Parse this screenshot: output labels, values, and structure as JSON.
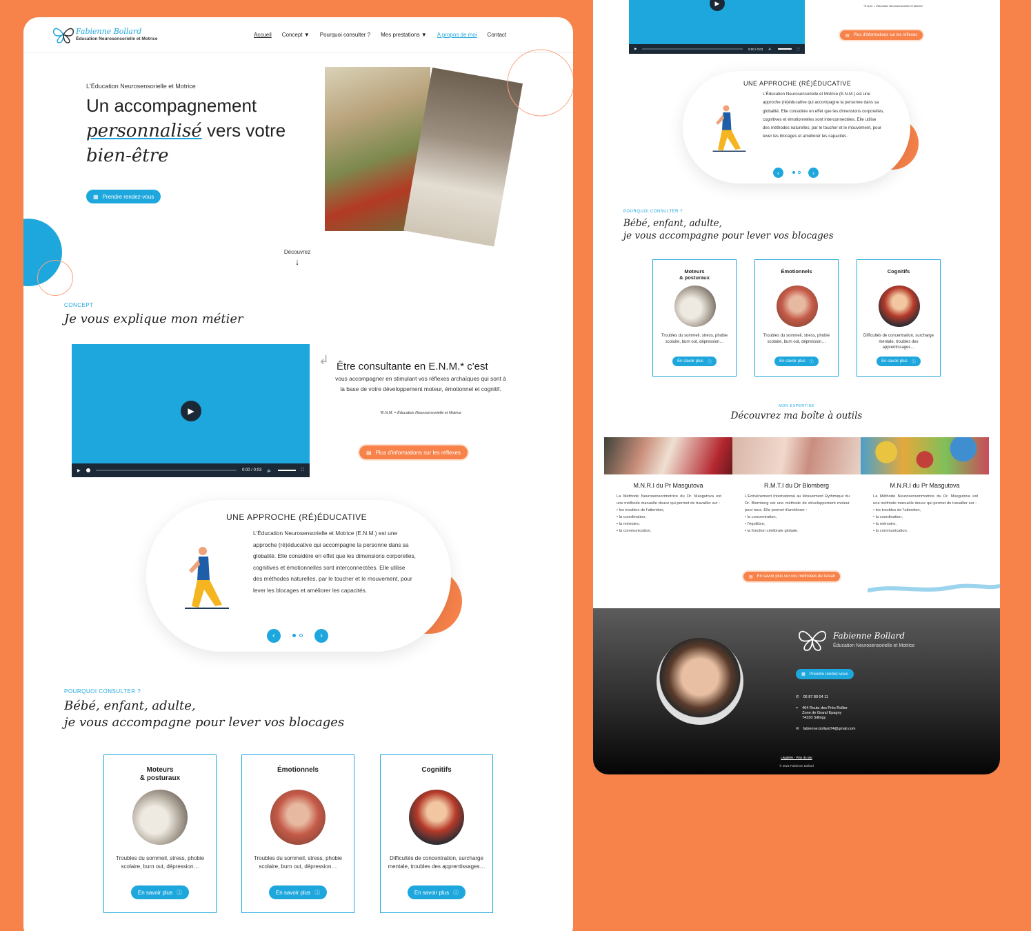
{
  "colors": {
    "background": "#f7824a",
    "accent_blue": "#1ea7dd",
    "accent_orange": "#f7824a",
    "dark": "#1b2937"
  },
  "brand": {
    "name": "Fabienne Bollard",
    "subtitle": "Éducation Neurosensorielle et Motrice"
  },
  "nav": {
    "items": [
      "Accueil",
      "Concept ▼",
      "Pourquoi consulter ?",
      "Mes prestations ▼",
      "A propos de moi",
      "Contact"
    ]
  },
  "hero": {
    "kicker": "L'Éducation Neurosensorielle et Motrice",
    "line1": "Un accompagnement",
    "line2_highlight": "personnalisé",
    "line2_rest": "vers votre",
    "line3": "bien-être",
    "cta": "Prendre rendez-vous",
    "discover": "Découvrez"
  },
  "concept": {
    "tag": "CONCEPT",
    "title": "Je vous explique mon métier",
    "heading": "Être consultante en E.N.M.* c'est",
    "text": "vous accompagner en stimulant vos réflexes archaïques qui sont à la base de votre développement moteur, émotionnel et cognitif.",
    "footnote": "*E.N.M. = Éducation Neurosensorielle et Motrice",
    "cta": "Plus d'informations sur les réflexes",
    "video_time": "0:00 / 0:03",
    "video_time_small": "0:00 / 0:03"
  },
  "approach": {
    "title": "UNE APPROCHE (RÉ)ÉDUCATIVE",
    "text": "L'Éducation Neurosensorielle et Motrice (E.N.M.) est une approche (ré)éducative qui accompagne la personne dans sa globalité. Elle considère en effet que les dimensions corporelles, cognitives et émotionnelles sont interconnectées. Elle utilise des méthodes naturelles, par le toucher et le mouvement, pour lever les blocages et améliorer les capacités.",
    "prev": "‹",
    "next": "›"
  },
  "why": {
    "tag": "POURQUOI CONSULTER ?",
    "title1": "Bébé, enfant, adulte,",
    "title2": "je vous accompagne pour lever vos blocages",
    "cards": [
      {
        "title": "Moteurs\n& posturaux",
        "desc": "Troubles du sommeil, stress, phobie scolaire, burn out, dépression…",
        "button": "En savoir plus"
      },
      {
        "title": "Émotionnels",
        "desc": "Troubles du sommeil, stress, phobie scolaire, burn out, dépression…",
        "button": "En savoir plus"
      },
      {
        "title": "Cognitifs",
        "desc": "Difficultés de concentration, surcharge mentale, troubles des apprentissages…",
        "button": "En savoir plus"
      }
    ]
  },
  "expertise": {
    "tag": "MON EXPERTISE",
    "title": "Découvrez ma boîte à outils",
    "tools": [
      {
        "title": "M.N.R.I du Pr Masgutova",
        "intro": "La Méthode Neurosensorimotrice du Dr. Masgutova est une méthode manuelle douce qui permet de travailler sur :",
        "points": [
          "les troubles de l'attention,",
          "la coordination,",
          "la mémoire,",
          "la communication."
        ]
      },
      {
        "title": "R.M.T.I du Dr Blomberg",
        "intro": "L'Entraînement International au Mouvement Rythmique du Dr. Blomberg est une méthode de développement moteur pour tous. Elle permet d'améliorer :",
        "points": [
          "la concentration,",
          "l'équilibre,",
          "la fonction cérébrale globale."
        ]
      },
      {
        "title": "M.N.R.I du Pr Masgutova",
        "intro": "La Méthode Neurosensorimotrice du Dr. Masgutova est une méthode manuelle douce qui permet de travailler sur :",
        "points": [
          "les troubles de l'attention,",
          "la coordination,",
          "la mémoire,",
          "la communication."
        ]
      }
    ],
    "cta": "En savoir plus sur ces méthodes de travail"
  },
  "footer": {
    "name": "Fabienne Bollard",
    "subtitle": "Éducation Neurosensorielle et Motrice",
    "cta": "Prendre rendez-vous",
    "phone": "06 87 80 04 11",
    "address1": "464 Route des Prés Rollier",
    "address2": "Zone de Grand Epagny",
    "address3": "74330 Sillingy",
    "email": "fabienne.bollard74@gmail.com",
    "legal": "Légalités - Plan du site",
    "copyright": "© 2024 Fabienne Bollard"
  },
  "icons": [
    "calendar-icon",
    "play-icon",
    "volume-icon",
    "fullscreen-icon",
    "info-icon",
    "document-icon",
    "phone-icon",
    "location-icon",
    "mail-icon",
    "down-arrow-icon"
  ]
}
